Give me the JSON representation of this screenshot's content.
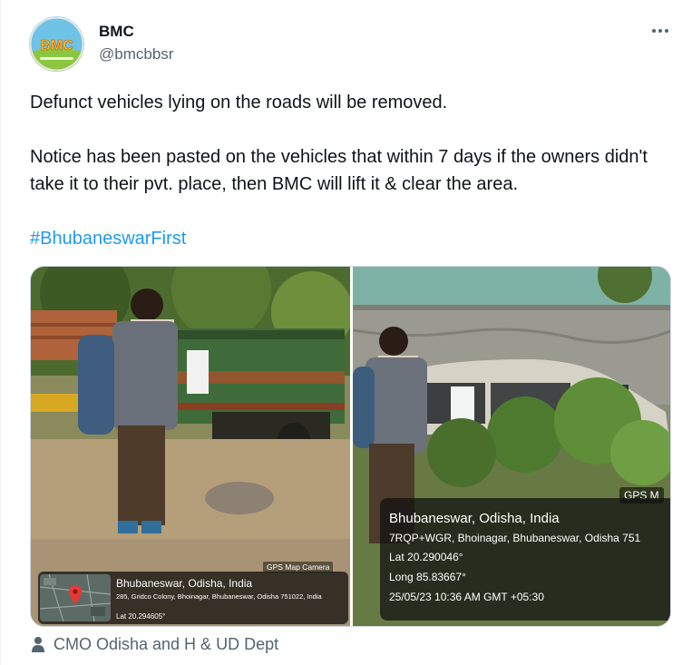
{
  "author": {
    "name": "BMC",
    "handle": "@bmcbbsr",
    "avatar_text": "BMC"
  },
  "tweet": {
    "line1": "Defunct vehicles lying on the roads will be removed.",
    "line2": "Notice has been pasted on the vehicles that within 7 days if the owners didn't take it to their pvt. place, then BMC will lift it & clear the area.",
    "hashtag": "#BhubaneswarFirst"
  },
  "photos": [
    {
      "camera_label": "GPS Map Camera",
      "city": "Bhubaneswar, Odisha, India",
      "address": "285, Gridco Colony, Bhoinagar, Bhubaneswar, Odisha 751022, India",
      "lat": "Lat 20.294605°"
    },
    {
      "camera_label": "GPS M",
      "city": "Bhubaneswar, Odisha, India",
      "address": "7RQP+WGR, Bhoinagar, Bhubaneswar, Odisha 751",
      "lat": "Lat 20.290046°",
      "long": "Long 85.83667°",
      "timestamp": "25/05/23 10:36 AM GMT +05:30"
    }
  ],
  "tagged": {
    "text": "CMO Odisha and H & UD Dept",
    "icon": "person-icon"
  },
  "colors": {
    "accent": "#1d9bf0",
    "secondary_text": "#536471"
  }
}
